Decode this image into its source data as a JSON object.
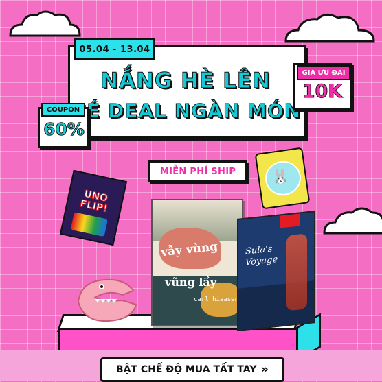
{
  "promo": {
    "date_range": "05.04 - 13.04",
    "headline_line1": "NẮNG HÈ LÊN",
    "headline_line2": "HÉ DEAL NGÀN MÓN",
    "price_label": "GIÁ ƯU ĐÃI",
    "price_value": "10K",
    "coupon_label": "COUPON",
    "coupon_value": "60%",
    "shipping_label": "MIỄN PHÍ SHIP"
  },
  "products": {
    "book1_title": "vẫy vùng",
    "book1_subtitle": "vũng lầy",
    "book1_author": "carl hiaasen",
    "book2_title": "Sula's Voyage",
    "card_game_title": "UNO FLIP!"
  },
  "cta": {
    "label": "BẬT CHẾ ĐỘ MUA TẤT TAY",
    "arrow": "»"
  },
  "colors": {
    "background": "#f46fc4",
    "accent_cyan": "#2de1ea",
    "accent_pink": "#ec2fa8"
  }
}
